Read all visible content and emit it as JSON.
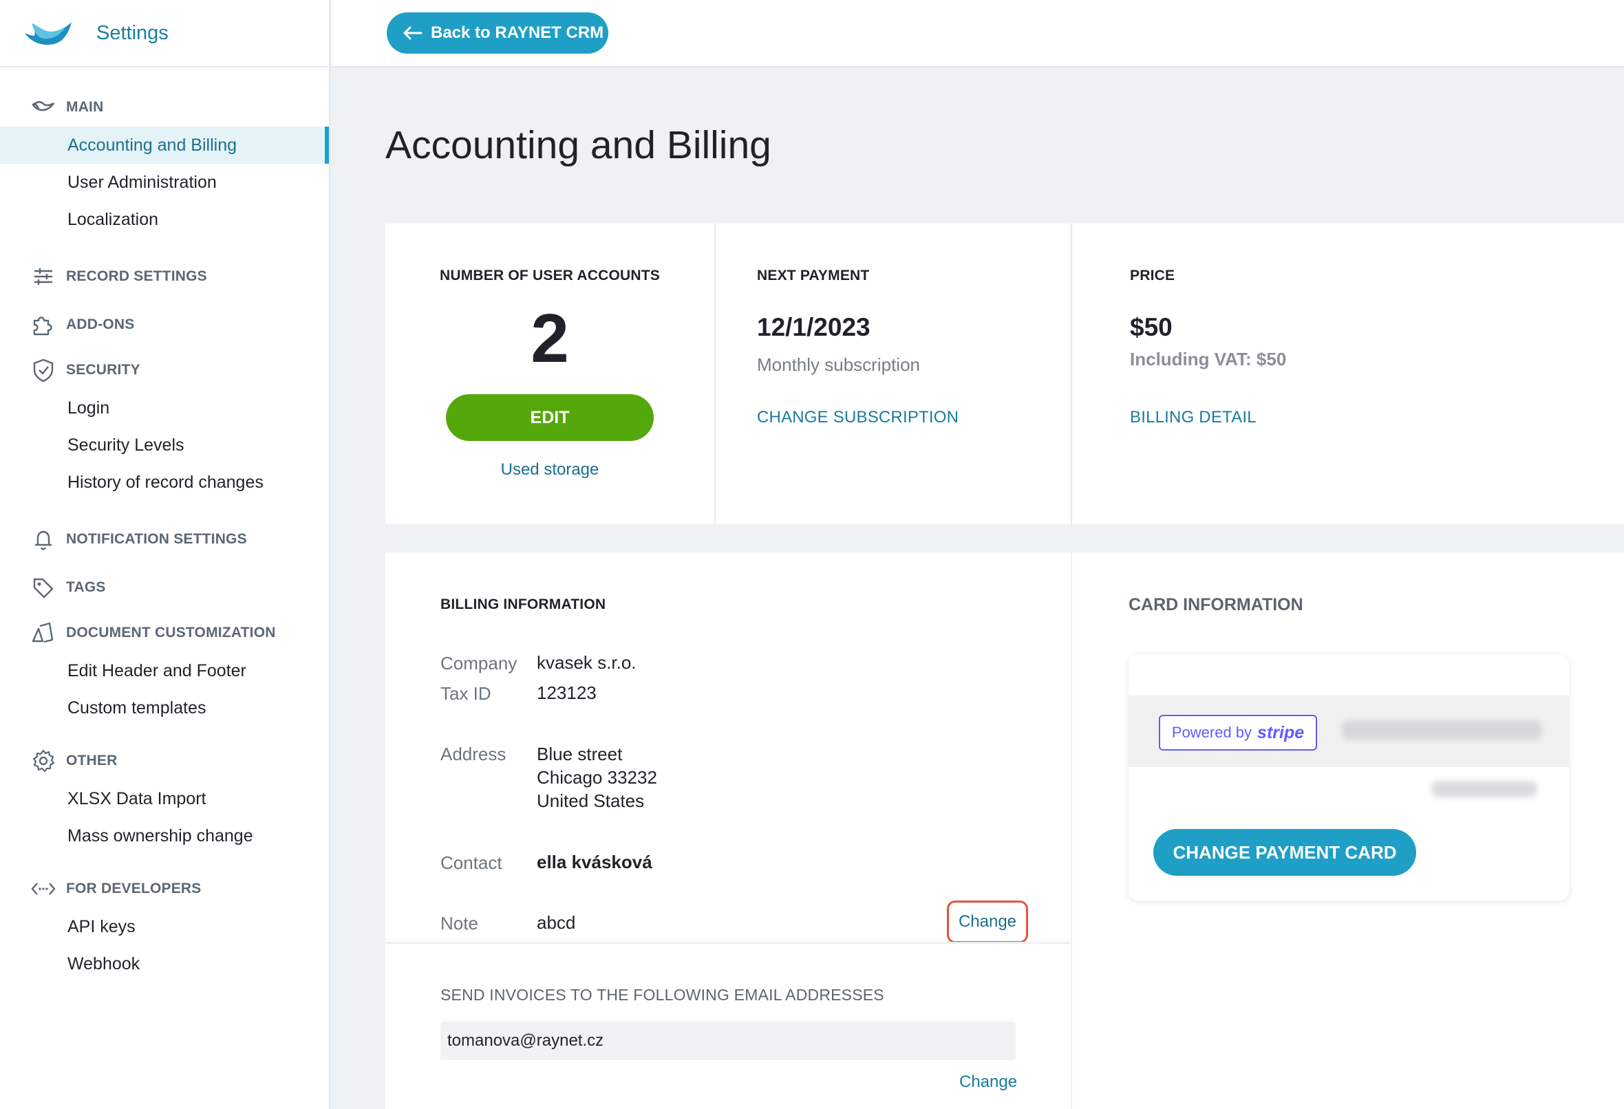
{
  "brand": {
    "title": "Settings"
  },
  "topbar": {
    "back_label": "Back to RAYNET CRM"
  },
  "sidebar": {
    "sections": [
      {
        "title": "MAIN",
        "icon": "raynet-bird-icon",
        "items": [
          "Accounting and Billing",
          "User Administration",
          "Localization"
        ]
      },
      {
        "title": "RECORD SETTINGS",
        "icon": "sliders-icon",
        "items": []
      },
      {
        "title": "ADD-ONS",
        "icon": "puzzle-icon",
        "items": []
      },
      {
        "title": "SECURITY",
        "icon": "shield-check-icon",
        "items": [
          "Login",
          "Security Levels",
          "History of record changes"
        ]
      },
      {
        "title": "NOTIFICATION SETTINGS",
        "icon": "bell-icon",
        "items": []
      },
      {
        "title": "TAGS",
        "icon": "tag-icon",
        "items": []
      },
      {
        "title": "DOCUMENT CUSTOMIZATION",
        "icon": "documents-icon",
        "items": [
          "Edit Header and Footer",
          "Custom templates"
        ]
      },
      {
        "title": "OTHER",
        "icon": "gear-icon",
        "items": [
          "XLSX Data Import",
          "Mass ownership change"
        ]
      },
      {
        "title": "FOR DEVELOPERS",
        "icon": "code-icon",
        "items": [
          "API keys",
          "Webhook"
        ]
      }
    ],
    "active_item": "Accounting and Billing"
  },
  "page": {
    "title": "Accounting and Billing"
  },
  "stats": {
    "users": {
      "label": "NUMBER OF USER ACCOUNTS",
      "count": "2",
      "edit_label": "EDIT",
      "storage_link": "Used storage"
    },
    "payment": {
      "label": "NEXT PAYMENT",
      "date": "12/1/2023",
      "subscription": "Monthly subscription",
      "link": "CHANGE SUBSCRIPTION"
    },
    "price": {
      "label": "PRICE",
      "amount": "$50",
      "vat": "Including VAT: $50",
      "link": "BILLING DETAIL"
    }
  },
  "billing": {
    "label": "BILLING INFORMATION",
    "company_label": "Company",
    "company": "kvasek s.r.o.",
    "taxid_label": "Tax ID",
    "taxid": "123123",
    "address_label": "Address",
    "address_lines": [
      "Blue street",
      "Chicago 33232",
      "United States"
    ],
    "contact_label": "Contact",
    "contact": "ella kvásková",
    "note_label": "Note",
    "note": "abcd",
    "change_label": "Change",
    "send_label": "SEND INVOICES TO THE FOLLOWING EMAIL ADDRESSES",
    "email": "tomanova@raynet.cz",
    "change_email_label": "Change"
  },
  "card": {
    "label": "CARD INFORMATION",
    "powered_by": "Powered by",
    "stripe": "stripe",
    "change_button": "CHANGE PAYMENT CARD"
  },
  "colors": {
    "accent": "#1f9fc6",
    "edit_green": "#55a80c",
    "highlight_red": "#e3533e",
    "stripe": "#635bff"
  }
}
